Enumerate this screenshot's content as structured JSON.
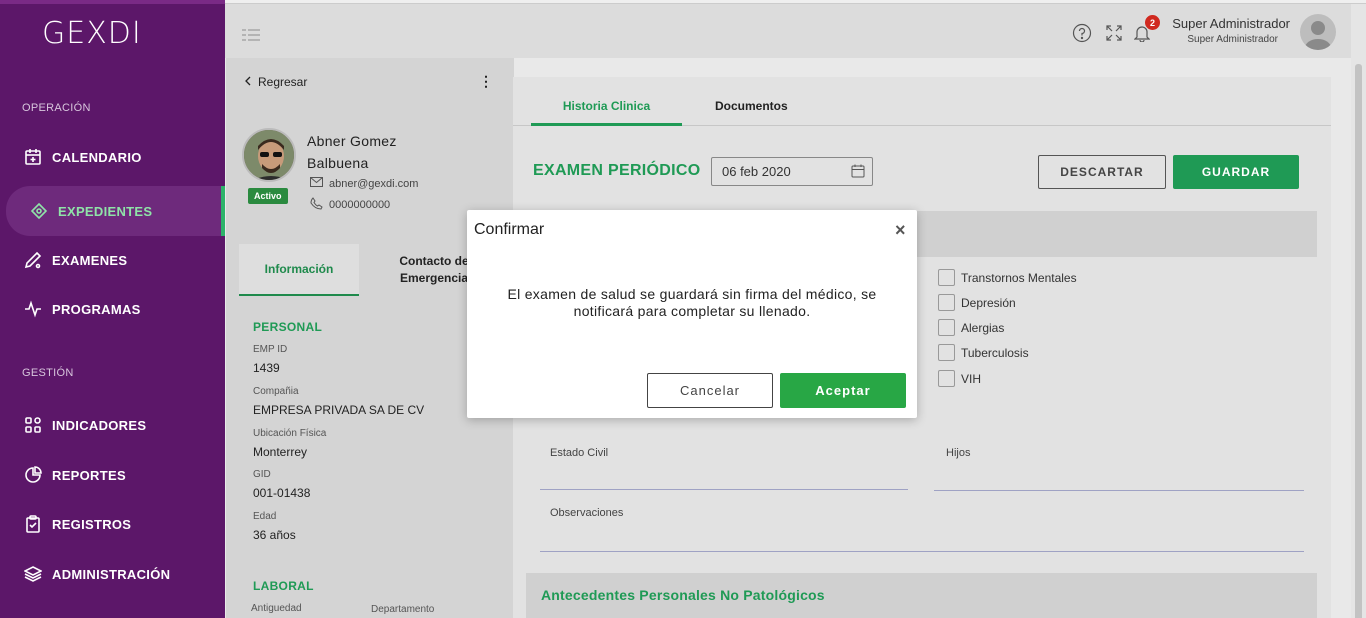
{
  "brand": {
    "logo_text": "GEXDI"
  },
  "sidebar": {
    "section_operation": "OPERACIÓN",
    "section_management": "GESTIÓN",
    "items": [
      {
        "label": "CALENDARIO",
        "icon": "calendar-icon"
      },
      {
        "label": "EXPEDIENTES",
        "icon": "bandage-icon",
        "active": true
      },
      {
        "label": "EXAMENES",
        "icon": "pen-icon"
      },
      {
        "label": "PROGRAMAS",
        "icon": "pulse-icon"
      },
      {
        "label": "INDICADORES",
        "icon": "grid-icon"
      },
      {
        "label": "REPORTES",
        "icon": "pie-chart-icon"
      },
      {
        "label": "REGISTROS",
        "icon": "clipboard-icon"
      },
      {
        "label": "ADMINISTRACIÓN",
        "icon": "layers-icon"
      }
    ],
    "active_color": "#8fe3a8"
  },
  "topbar": {
    "notification_count": "2",
    "user_name": "Super Administrador",
    "user_role": "Super Administrador"
  },
  "patient": {
    "back_label": "Regresar",
    "name": "Abner Gomez Balbuena",
    "status": "Activo",
    "email": "abner@gexdi.com",
    "phone": "0000000000",
    "tabs": [
      "Información",
      "Contacto de Emergencia"
    ],
    "personal_heading": "PERSONAL",
    "fields": [
      {
        "label": "EMP ID",
        "value": "1439"
      },
      {
        "label": "Compañia",
        "value": "EMPRESA PRIVADA SA DE CV"
      },
      {
        "label": "Ubicación Física",
        "value": "Monterrey"
      },
      {
        "label": "GID",
        "value": "001-01438"
      },
      {
        "label": "Edad",
        "value": "36 años"
      }
    ],
    "labor_heading": "LABORAL",
    "labor_fields": [
      "Antiguedad",
      "Departamento"
    ]
  },
  "main": {
    "tabs": [
      "Historia Clinica",
      "Documentos"
    ],
    "exam_title": "EXAMEN PERIÓDICO",
    "date_value": "06 feb 2020",
    "discard_label": "DESCARTAR",
    "save_label": "GUARDAR",
    "checkboxes": [
      "Transtornos Mentales",
      "Depresión",
      "Alergias",
      "Tuberculosis",
      "VIH"
    ],
    "estado_civil_label": "Estado Civil",
    "hijos_label": "Hijos",
    "observaciones_label": "Observaciones",
    "non_pathological_title": "Antecedentes Personales No Patológicos",
    "accent_color": "#1f9a55"
  },
  "modal": {
    "title": "Confirmar",
    "close": "×",
    "message": "El examen de salud se guardará sin firma del médico, se notificará para completar su llenado.",
    "cancel_label": "Cancelar",
    "accept_label": "Aceptar"
  }
}
